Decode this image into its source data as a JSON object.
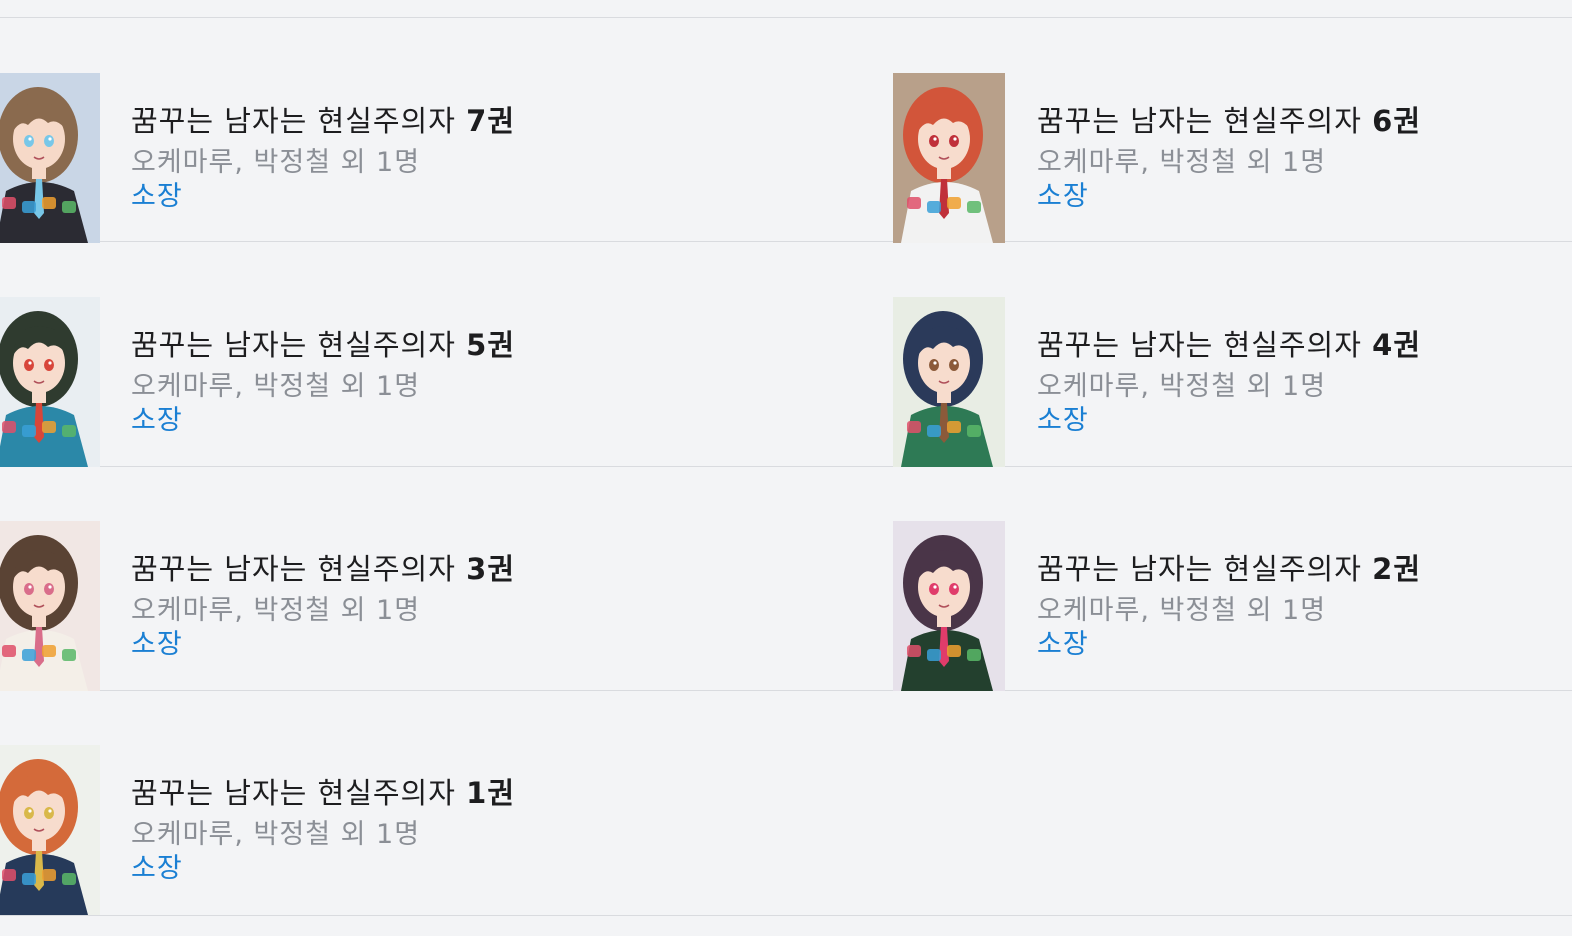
{
  "items": [
    {
      "title": "꿈꾸는 남자는 현실주의자",
      "volume": "7권",
      "author": "오케마루, 박정철 외 1명",
      "status": "소장",
      "cover": {
        "bg": "#c9d6e6",
        "hair": "#8a6a4e",
        "skin": "#f6d9c8",
        "outfit": "#2b2b33",
        "accent": "#78c7e8"
      }
    },
    {
      "title": "꿈꾸는 남자는 현실주의자",
      "volume": "6권",
      "author": "오케마루, 박정철 외 1명",
      "status": "소장",
      "cover": {
        "bg": "#b8a08a",
        "hair": "#d2553a",
        "skin": "#f7dccd",
        "outfit": "#f2f2f2",
        "accent": "#c0303a"
      }
    },
    {
      "title": "꿈꾸는 남자는 현실주의자",
      "volume": "5권",
      "author": "오케마루, 박정철 외 1명",
      "status": "소장",
      "cover": {
        "bg": "#e9eef2",
        "hair": "#2f3b2f",
        "skin": "#f7dccd",
        "outfit": "#2b88a8",
        "accent": "#d8463a"
      }
    },
    {
      "title": "꿈꾸는 남자는 현실주의자",
      "volume": "4권",
      "author": "오케마루, 박정철 외 1명",
      "status": "소장",
      "cover": {
        "bg": "#e8ede4",
        "hair": "#2b3a5a",
        "skin": "#f7dccd",
        "outfit": "#2e7a55",
        "accent": "#8b5a3a"
      }
    },
    {
      "title": "꿈꾸는 남자는 현실주의자",
      "volume": "3권",
      "author": "오케마루, 박정철 외 1명",
      "status": "소장",
      "cover": {
        "bg": "#f1e7e4",
        "hair": "#5a4334",
        "skin": "#f7dccd",
        "outfit": "#f4efe8",
        "accent": "#d96d8a"
      }
    },
    {
      "title": "꿈꾸는 남자는 현실주의자",
      "volume": "2권",
      "author": "오케마루, 박정철 외 1명",
      "status": "소장",
      "cover": {
        "bg": "#e6e1ea",
        "hair": "#4a3548",
        "skin": "#f7dccd",
        "outfit": "#23402e",
        "accent": "#e03c6a"
      }
    },
    {
      "title": "꿈꾸는 남자는 현실주의자",
      "volume": "1권",
      "author": "오케마루, 박정철 외 1명",
      "status": "소장",
      "cover": {
        "bg": "#eef1ec",
        "hair": "#d46a3a",
        "skin": "#f7dccd",
        "outfit": "#263a5a",
        "accent": "#d9b84a"
      }
    }
  ]
}
